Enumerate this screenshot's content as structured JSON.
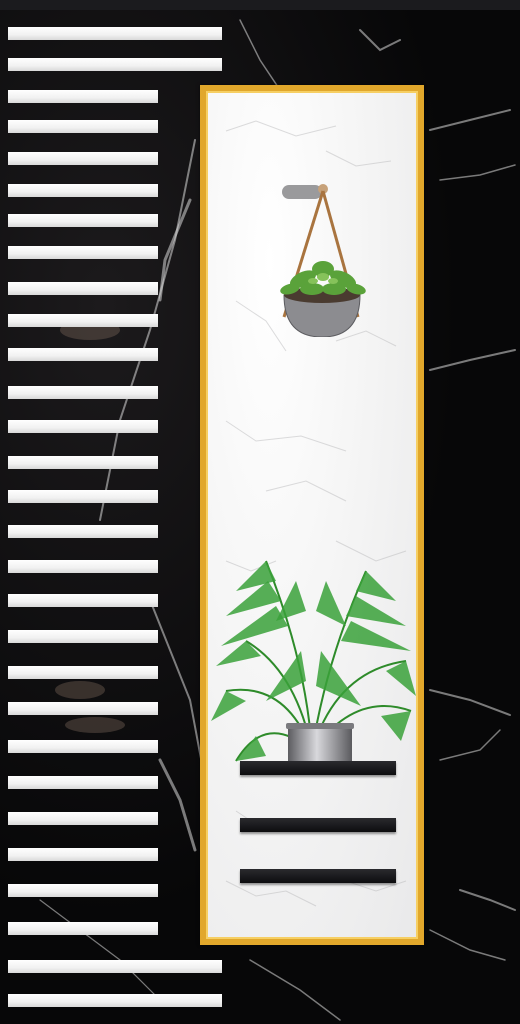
{
  "scene": {
    "background": "black-marble",
    "frame_color": "#e1a72b",
    "panel_color": "#f5f5f5",
    "stripe_color": "#ffffff",
    "shelf_color": "#111113",
    "objects": [
      "hanging-planter-icon",
      "palm-plant-icon",
      "shelf",
      "shelf",
      "shelf"
    ]
  }
}
